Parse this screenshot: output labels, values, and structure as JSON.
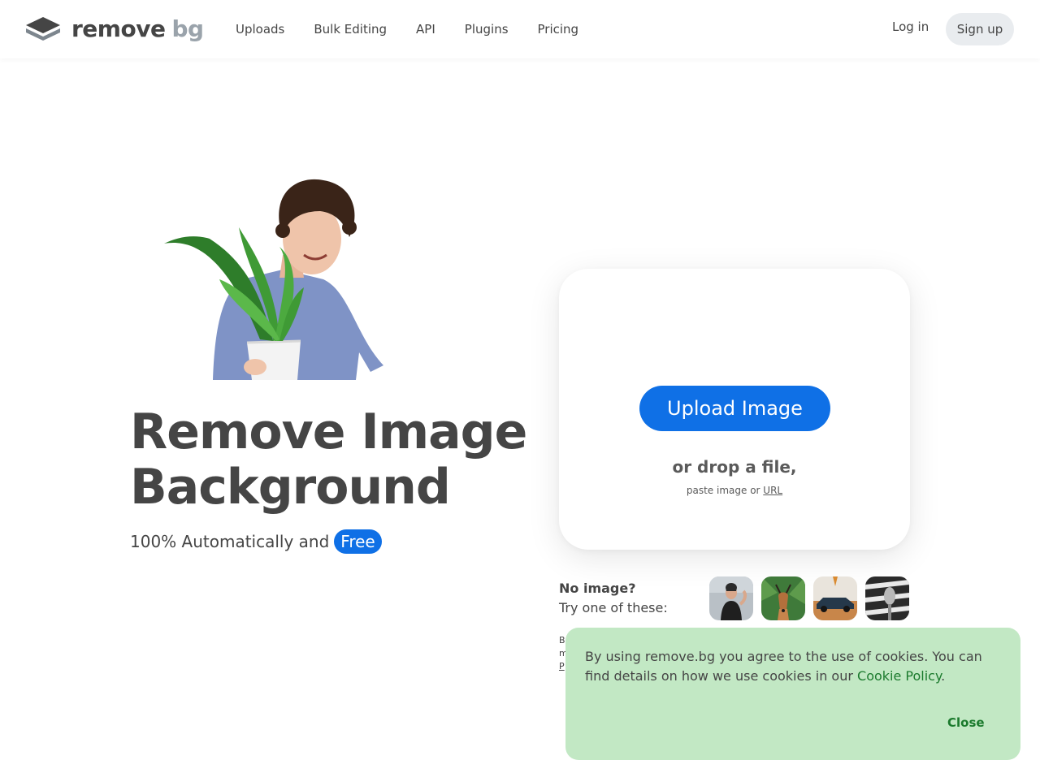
{
  "logo": {
    "word1": "remove",
    "word2": "bg"
  },
  "nav": {
    "items": [
      {
        "label": "Uploads"
      },
      {
        "label": "Bulk Editing"
      },
      {
        "label": "API"
      },
      {
        "label": "Plugins"
      },
      {
        "label": "Pricing"
      }
    ],
    "login_label": "Log in",
    "signup_label": "Sign up"
  },
  "hero": {
    "headline_line1": "Remove Image",
    "headline_line2": "Background",
    "subline": "100% Automatically and",
    "free_badge": "Free"
  },
  "upload": {
    "button_label": "Upload Image",
    "drop_text": "or drop a file,",
    "paste_text": "paste image or",
    "url_link": "URL"
  },
  "samples": {
    "prompt_line1": "No image?",
    "prompt_line2": "Try one of these:",
    "thumbnails": [
      "woman-sample",
      "deer-sample",
      "car-sample",
      "microphone-sample"
    ]
  },
  "legal": {
    "line1": "B",
    "line2": "m",
    "line3": "P"
  },
  "cookie_banner": {
    "text": "By using remove.bg you agree to the use of cookies. You can find details on how we use cookies in our",
    "policy_link": "Cookie Policy",
    "period": ".",
    "close_label": "Close"
  },
  "colors": {
    "accent_blue": "#0f70e6",
    "text": "#454545",
    "cookie_bg": "#c2e8c4",
    "cookie_link": "#1b7a2d",
    "signup_bg": "#e9ecef"
  }
}
